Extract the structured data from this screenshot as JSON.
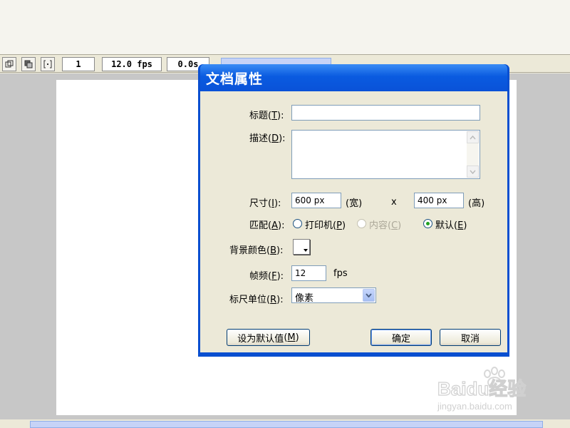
{
  "timeline": {
    "current_frame": "1",
    "frame_rate": "12.0 fps",
    "elapsed_time": "0.0s"
  },
  "dialog": {
    "title": "文档属性",
    "title_field": {
      "label": "标题",
      "accesskey": "T",
      "value": ""
    },
    "description_field": {
      "label": "描述",
      "accesskey": "D",
      "value": ""
    },
    "dimensions": {
      "label": "尺寸",
      "accesskey": "I",
      "width_value": "600 px",
      "width_unit": "(宽)",
      "separator": "x",
      "height_value": "400 px",
      "height_unit": "(高)"
    },
    "match": {
      "label": "匹配",
      "accesskey": "A",
      "options": [
        {
          "label": "打印机",
          "accesskey": "P",
          "checked": false,
          "disabled": false
        },
        {
          "label": "内容",
          "accesskey": "C",
          "checked": false,
          "disabled": true
        },
        {
          "label": "默认",
          "accesskey": "E",
          "checked": true,
          "disabled": false
        }
      ]
    },
    "background_color": {
      "label": "背景颜色",
      "accesskey": "B",
      "value": "#ffffff"
    },
    "frame_rate": {
      "label": "帧频",
      "accesskey": "F",
      "value": "12",
      "unit": "fps"
    },
    "ruler_units": {
      "label": "标尺单位",
      "accesskey": "R",
      "selected": "像素"
    },
    "buttons": {
      "make_default": {
        "label": "设为默认值",
        "accesskey": "M"
      },
      "ok": "确定",
      "cancel": "取消"
    }
  },
  "watermark": {
    "brand": "Baidu经验",
    "url": "jingyan.baidu.com"
  },
  "colors": {
    "titlebar": "#0a5be0",
    "dialog_bg": "#ece9d8",
    "stage_bg": "#c7c7c7",
    "field_border": "#7f9db9"
  }
}
